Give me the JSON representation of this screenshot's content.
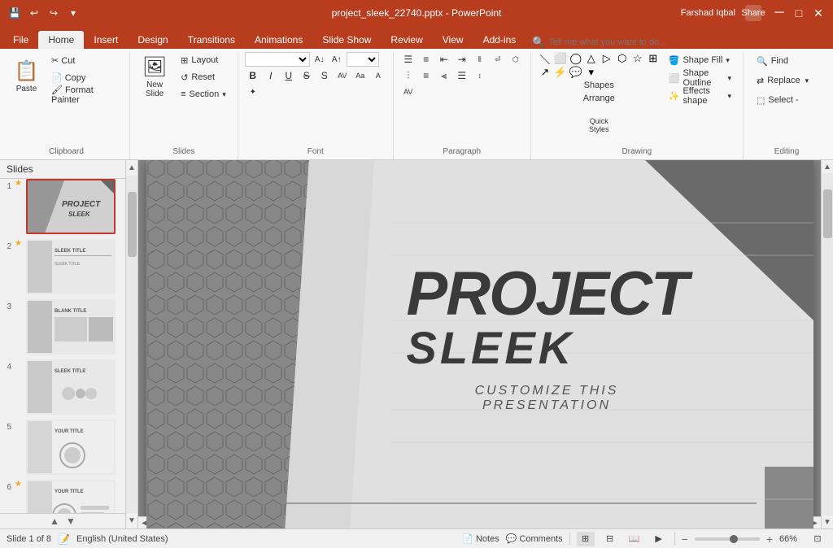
{
  "titlebar": {
    "title": "project_sleek_22740.pptx - PowerPoint",
    "minimize": "─",
    "maximize": "□",
    "close": "✕"
  },
  "qat": {
    "save": "💾",
    "undo": "↩",
    "redo": "↪",
    "customize": "▾"
  },
  "user": {
    "name": "Farshad Iqbal"
  },
  "ribbon_tabs": [
    {
      "label": "File",
      "active": false
    },
    {
      "label": "Home",
      "active": true
    },
    {
      "label": "Insert",
      "active": false
    },
    {
      "label": "Design",
      "active": false
    },
    {
      "label": "Transitions",
      "active": false
    },
    {
      "label": "Animations",
      "active": false
    },
    {
      "label": "Slide Show",
      "active": false
    },
    {
      "label": "Review",
      "active": false
    },
    {
      "label": "View",
      "active": false
    },
    {
      "label": "Add-ins",
      "active": false
    }
  ],
  "ribbon": {
    "clipboard_label": "Clipboard",
    "slides_label": "Slides",
    "font_label": "Font",
    "paragraph_label": "Paragraph",
    "drawing_label": "Drawing",
    "editing_label": "Editing",
    "paste_label": "Paste",
    "new_slide_label": "New\nSlide",
    "layout_label": "Layout",
    "reset_label": "Reset",
    "section_label": "Section",
    "shapes_label": "Shapes",
    "arrange_label": "Arrange",
    "quick_styles_label": "Quick\nStyles",
    "shape_fill_label": "Shape Fill",
    "shape_outline_label": "Shape Outline",
    "shape_effects_label": "Effects shape",
    "select_label": "Select -",
    "find_label": "Find",
    "replace_label": "Replace",
    "bold_label": "B",
    "italic_label": "I",
    "underline_label": "U",
    "strikethrough_label": "S",
    "font_name": "",
    "font_size": "",
    "tell_me_placeholder": "Tell me what you want to do...",
    "share_label": "Share"
  },
  "slides_panel": {
    "header": "Slides",
    "slides": [
      {
        "number": "1",
        "star": "★",
        "selected": true
      },
      {
        "number": "2",
        "star": "★",
        "selected": false
      },
      {
        "number": "3",
        "star": "",
        "selected": false
      },
      {
        "number": "4",
        "star": "",
        "selected": false
      },
      {
        "number": "5",
        "star": "",
        "selected": false
      },
      {
        "number": "6",
        "star": "★",
        "selected": false
      }
    ]
  },
  "slide_content": {
    "project_text": "PROJECT",
    "sleek_text": "SLEEK",
    "customize_line1": "CUSTOMIZE THIS",
    "customize_line2": "PRESENTATION"
  },
  "status_bar": {
    "slide_info": "Slide 1 of 8",
    "language": "English (United States)",
    "notes_label": "Notes",
    "comments_label": "Comments",
    "zoom_level": "66%",
    "zoom_percent": "66"
  }
}
